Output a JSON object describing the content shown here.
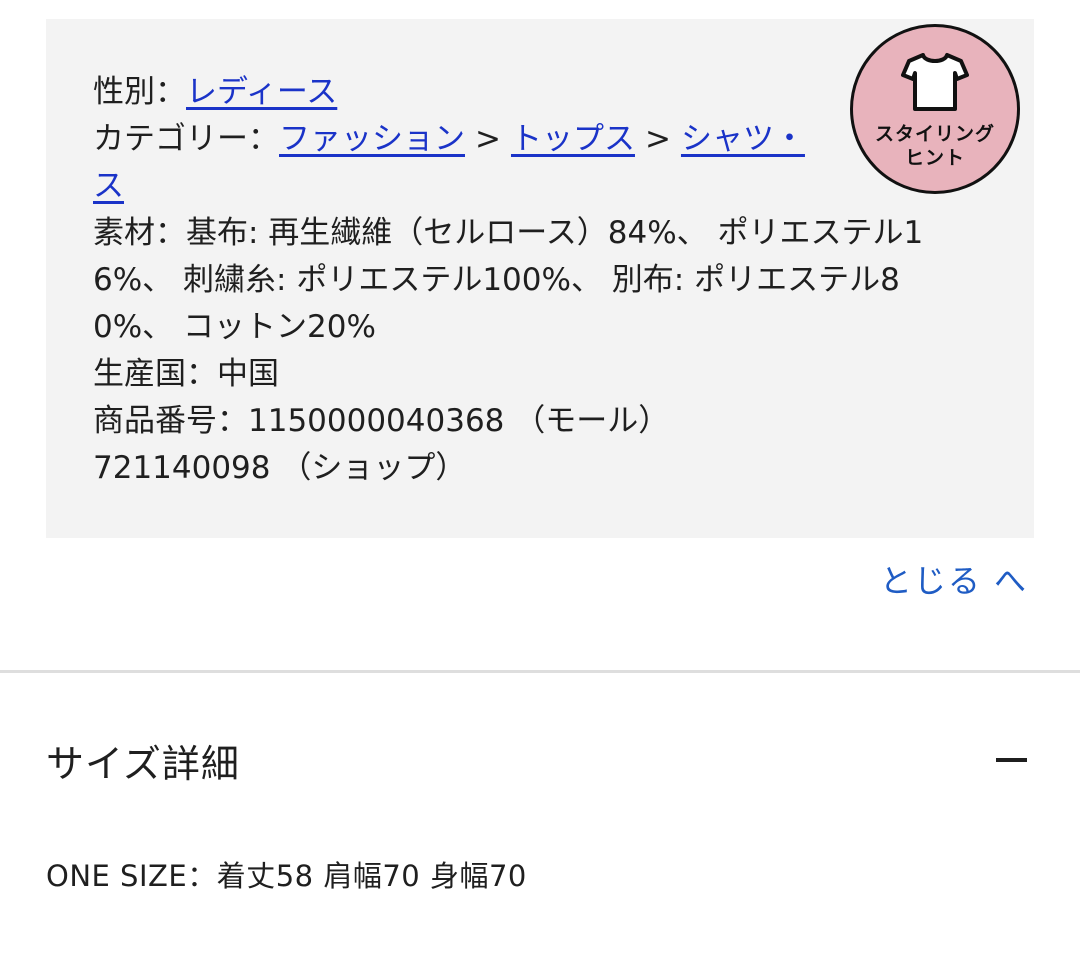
{
  "details": {
    "gender_label": "性別：",
    "gender_value": "レディース",
    "category_label": "カテゴリー：",
    "category_1": "ファッション",
    "category_sep_1": ">",
    "category_2": "トップス",
    "category_sep_2": ">",
    "category_3_part1": "シャツ・",
    "category_3_part2": "ス",
    "material_line_1": "素材：基布: 再生繊維（セルロース）84%、 ポリエステル1",
    "material_line_2": "6%、 刺繍糸: ポリエステル100%、 別布: ポリエステル8",
    "material_line_3": "0%、 コットン20%",
    "origin": "生産国：中国",
    "product_number_line_1": "商品番号：1150000040368 （モール）",
    "product_number_line_2": "721140098 （ショップ）"
  },
  "badge": {
    "line_1": "スタイリング",
    "line_2": "ヒント",
    "icon": "tshirt-icon",
    "color": "#e8b3bc"
  },
  "close_link": "とじる へ",
  "size_section": {
    "title": "サイズ詳細",
    "toggle_icon": "minus-icon",
    "size_line": "ONE SIZE：着丈58 肩幅70 身幅70"
  },
  "colors": {
    "link": "#1a33c8",
    "close_link": "#1f5cc4",
    "box_background": "#f3f3f3"
  }
}
